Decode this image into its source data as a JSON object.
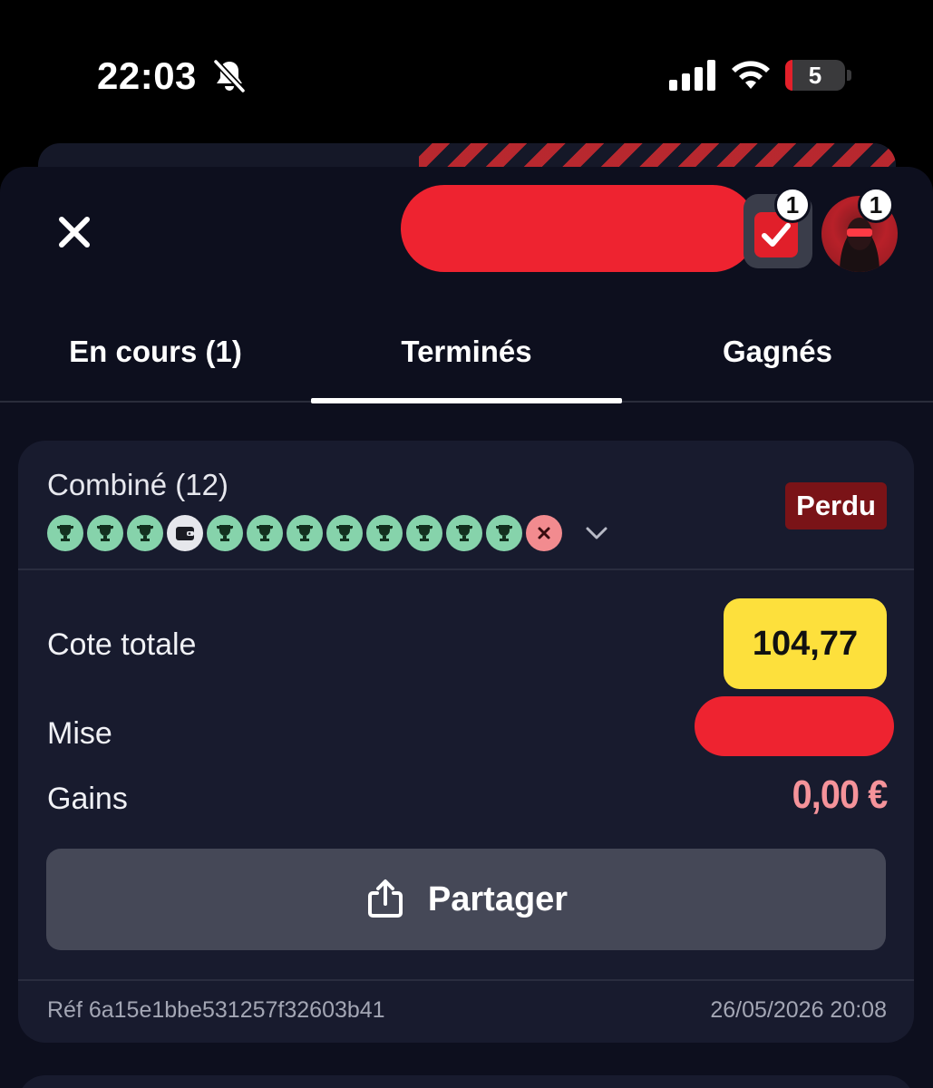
{
  "status_bar": {
    "time": "22:03",
    "battery": "5",
    "icons": [
      "bell-slash-icon",
      "cellular-signal-icon",
      "wifi-icon",
      "battery-icon"
    ]
  },
  "header": {
    "close_icon": "close-icon",
    "bets_badge": "1",
    "avatar_badge": "1"
  },
  "tabs": [
    {
      "label": "En cours (1)",
      "active": false
    },
    {
      "label": "Terminés",
      "active": true
    },
    {
      "label": "Gagnés",
      "active": false
    }
  ],
  "bet": {
    "title": "Combiné (12)",
    "status": "Perdu",
    "legs": [
      "won",
      "won",
      "won",
      "wallet",
      "won",
      "won",
      "won",
      "won",
      "won",
      "won",
      "won",
      "lost"
    ],
    "odds_label": "Cote totale",
    "odds_value": "104,77",
    "stake_label": "Mise",
    "gains_label": "Gains",
    "gains_value": "0,00 €",
    "share_label": "Partager",
    "ref": "Réf 6a15e1bbe531257f32603b41",
    "date": "26/05/2026 20:08"
  },
  "colors": {
    "background": "#0d0f1e",
    "card": "#181b2e",
    "odds_box": "#fde03c",
    "lost_badge": "#7a1317",
    "gains": "#f5939a",
    "won_leg": "#86d3ab",
    "lost_leg": "#f28b8f"
  }
}
